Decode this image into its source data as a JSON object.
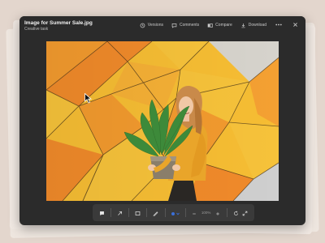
{
  "window": {
    "title": "Image for Summer Sale.jpg",
    "subtitle": "Creative task"
  },
  "header_actions": [
    {
      "label": "Versions",
      "icon": "history-icon"
    },
    {
      "label": "Comments",
      "icon": "comment-icon"
    },
    {
      "label": "Compare",
      "icon": "compare-icon"
    },
    {
      "label": "Download",
      "icon": "download-icon"
    }
  ],
  "header_icons": [
    "more-icon",
    "close-icon"
  ],
  "toolbar": {
    "zoom": "100%",
    "tools": [
      "comment-tool-icon",
      "arrow-tool-icon",
      "rectangle-tool-icon",
      "pen-tool-icon",
      "color-picker-icon",
      "zoom-out-icon",
      "zoom-in-icon",
      "rotate-icon",
      "fullscreen-icon"
    ],
    "active_color": "#3b6fd8"
  },
  "colors": {
    "window_bg": "#2b2b2b",
    "photo_orange": "#f08a2a",
    "photo_yellow": "#f6c23a",
    "photo_grey": "#cfcfcf",
    "accent": "#3b6fd8"
  }
}
